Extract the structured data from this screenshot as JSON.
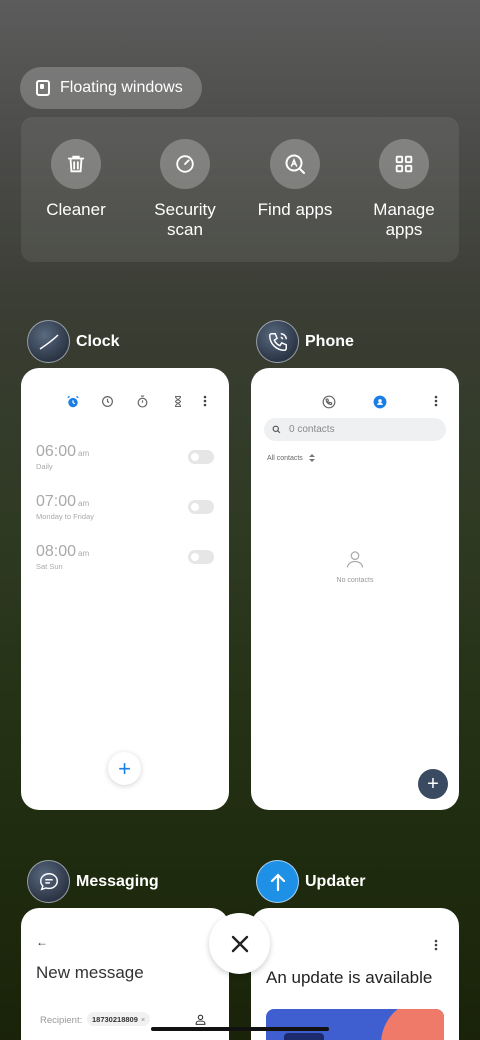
{
  "floating_windows": {
    "label": "Floating windows",
    "icon": "floating-window-icon"
  },
  "tools": [
    {
      "label": "Cleaner",
      "icon": "trash-icon"
    },
    {
      "label": "Security scan",
      "line1": "Security",
      "line2": "scan",
      "icon": "security-scan-icon"
    },
    {
      "label": "Find apps",
      "icon": "find-apps-icon"
    },
    {
      "label": "Manage apps",
      "line1": "Manage",
      "line2": "apps",
      "icon": "grid-icon"
    }
  ],
  "apps": {
    "clock": {
      "name": "Clock",
      "alarms": [
        {
          "time": "06:00",
          "ampm": "am",
          "repeat": "Daily",
          "enabled": false
        },
        {
          "time": "07:00",
          "ampm": "am",
          "repeat": "Monday to Friday",
          "enabled": false
        },
        {
          "time": "08:00",
          "ampm": "am",
          "repeat": "Sat Sun",
          "enabled": false
        }
      ],
      "fab": "+"
    },
    "phone": {
      "name": "Phone",
      "search_placeholder": "0 contacts",
      "filter": "All contacts",
      "empty": "No contacts",
      "fab": "+"
    },
    "messaging": {
      "name": "Messaging",
      "title": "New message",
      "recipient_label": "Recipient:",
      "recipient_chip": "18730218809"
    },
    "updater": {
      "name": "Updater",
      "title": "An update is available"
    }
  },
  "colors": {
    "accent": "#1a7ee6",
    "phone_fab": "#3a4a60",
    "updater_icon": "#1e90e6"
  }
}
